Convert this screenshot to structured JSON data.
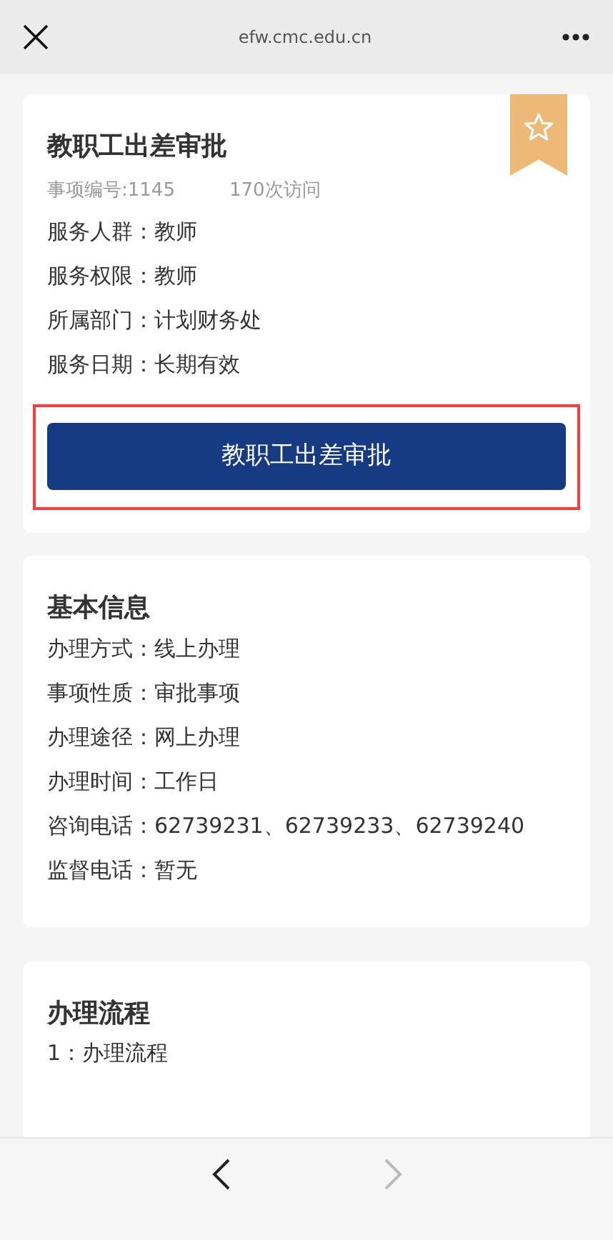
{
  "top_bar": {
    "url": "efw.cmc.edu.cn"
  },
  "service": {
    "title": "教职工出差审批",
    "favorited": false,
    "item_number": "事项编号:1145",
    "visits": "170次访问",
    "fields": [
      {
        "label": "服务人群：",
        "value": "教师"
      },
      {
        "label": "服务权限：",
        "value": "教师"
      },
      {
        "label": "所属部门：",
        "value": "计划财务处"
      },
      {
        "label": "服务日期：",
        "value": "长期有效"
      }
    ],
    "action_button": {
      "label": "教职工出差审批",
      "highlighted": true
    }
  },
  "basic_info": {
    "title": "基本信息",
    "fields": [
      {
        "label": "办理方式：",
        "value": "线上办理"
      },
      {
        "label": "事项性质：",
        "value": "审批事项"
      },
      {
        "label": "办理途径：",
        "value": "网上办理"
      },
      {
        "label": "办理时间：",
        "value": "工作日"
      },
      {
        "label": "咨询电话：",
        "value": "62739231、62739233、62739240"
      },
      {
        "label": "监督电话：",
        "value": "暂无"
      }
    ]
  },
  "process": {
    "title": "办理流程",
    "steps": [
      "1：办理流程"
    ]
  },
  "bottom_bar": {
    "back_disabled": false,
    "forward_disabled": true
  }
}
